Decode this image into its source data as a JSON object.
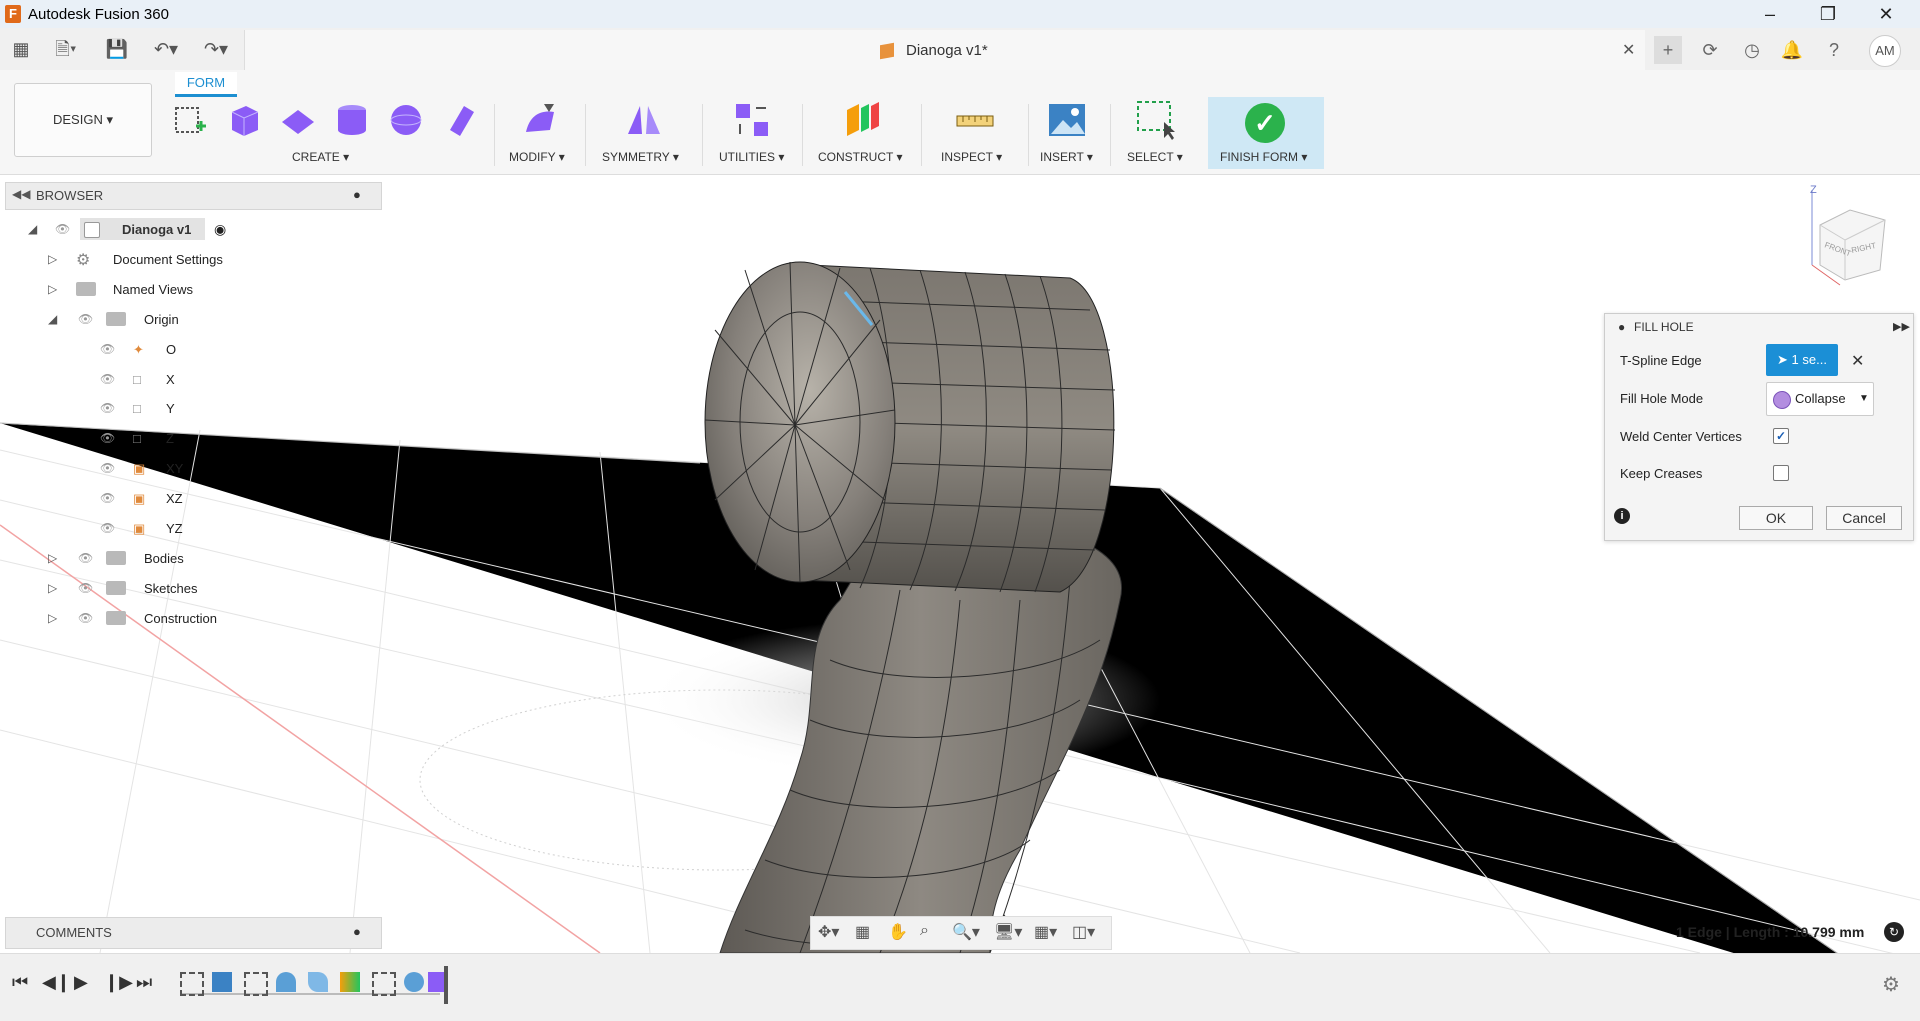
{
  "app": {
    "title": "Autodesk Fusion 360"
  },
  "document": {
    "title": "Dianoga v1*"
  },
  "user": {
    "initials": "AM"
  },
  "ribbon": {
    "workspace": "DESIGN ▾",
    "active_tab": "FORM",
    "groups": {
      "create": "CREATE ▾",
      "modify": "MODIFY ▾",
      "symmetry": "SYMMETRY ▾",
      "utilities": "UTILITIES ▾",
      "construct": "CONSTRUCT ▾",
      "inspect": "INSPECT ▾",
      "insert": "INSERT ▾",
      "select": "SELECT ▾",
      "finish_form": "FINISH FORM ▾"
    }
  },
  "browser": {
    "title": "BROWSER",
    "root": "Dianoga v1",
    "items": [
      {
        "label": "Document Settings"
      },
      {
        "label": "Named Views"
      },
      {
        "label": "Origin"
      },
      {
        "label": "O"
      },
      {
        "label": "X"
      },
      {
        "label": "Y"
      },
      {
        "label": "Z"
      },
      {
        "label": "XY"
      },
      {
        "label": "XZ"
      },
      {
        "label": "YZ"
      },
      {
        "label": "Bodies"
      },
      {
        "label": "Sketches"
      },
      {
        "label": "Construction"
      }
    ]
  },
  "fill_hole": {
    "title": "FILL HOLE",
    "tspline_edge_label": "T-Spline Edge",
    "tspline_edge_value": "1 se...",
    "fill_hole_mode_label": "Fill Hole Mode",
    "fill_hole_mode_value": "Collapse",
    "weld_center_label": "Weld Center Vertices",
    "weld_center_checked": true,
    "keep_creases_label": "Keep Creases",
    "keep_creases_checked": false,
    "ok": "OK",
    "cancel": "Cancel"
  },
  "comments": {
    "title": "COMMENTS"
  },
  "status": {
    "text": "1 Edge | Length : 10.799 mm"
  },
  "viewcube": {
    "front": "FRONT",
    "right": "RIGHT",
    "z": "Z"
  },
  "colors": {
    "accent": "#1d8fd1",
    "finish": "#2bb24c",
    "tspline": "#7a746b"
  }
}
